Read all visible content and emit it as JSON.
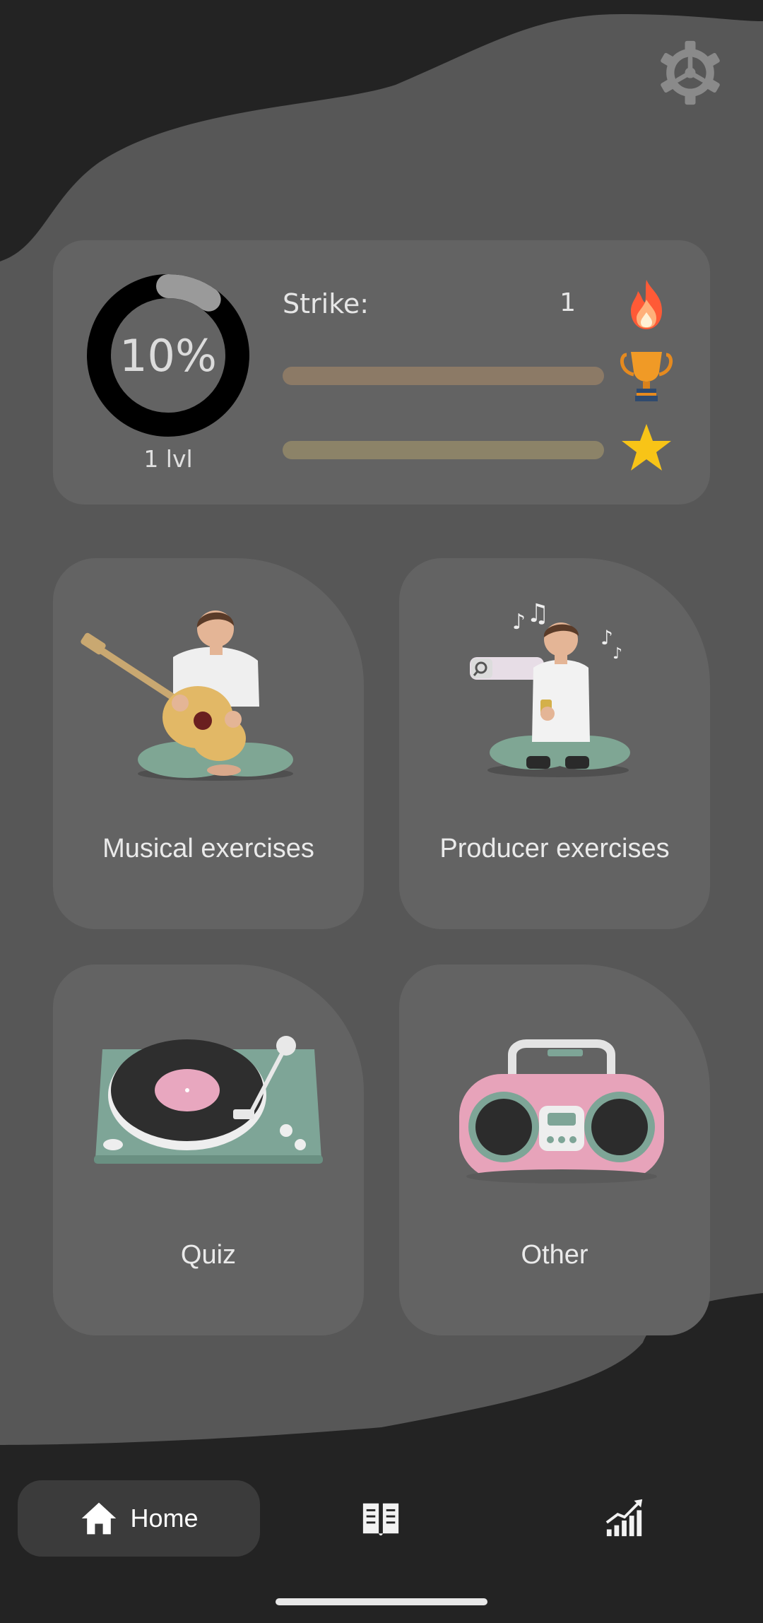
{
  "colors": {
    "background": "#232323",
    "blob": "#575757",
    "card": "#636363",
    "nav_active": "#3b3b3b",
    "ring_track": "#000000",
    "ring_progress": "#9a9a9a",
    "fire": "#ff5a36",
    "trophy": "#e58a1f",
    "star": "#f8c417"
  },
  "header": {
    "settings_icon": "gear-icon"
  },
  "stats": {
    "progress_percent": 10,
    "progress_label": "10%",
    "level_label": "1 lvl",
    "strike_label": "Strike:",
    "strike_count": "1",
    "icons": [
      "fire-icon",
      "trophy-icon",
      "star-icon"
    ]
  },
  "cards": [
    {
      "label": "Musical exercises",
      "icon": "guitarist-illustration"
    },
    {
      "label": "Producer exercises",
      "icon": "producer-illustration"
    },
    {
      "label": "Quiz",
      "icon": "turntable-illustration"
    },
    {
      "label": "Other",
      "icon": "boombox-illustration"
    }
  ],
  "nav": {
    "home_label": "Home",
    "home_icon": "home-icon",
    "book_icon": "book-icon",
    "stats_icon": "stats-icon"
  }
}
